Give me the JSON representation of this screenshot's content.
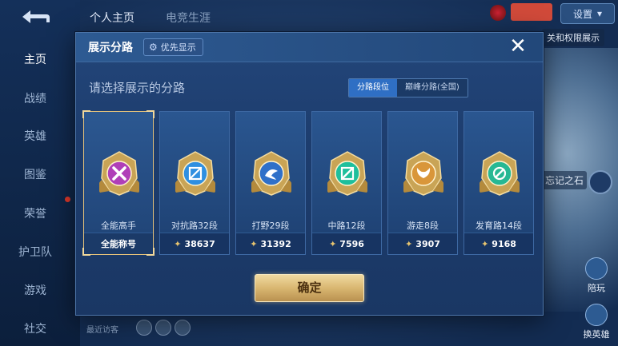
{
  "background": {
    "top_tabs": [
      "个人主页",
      "电竞生涯"
    ],
    "sidebar": [
      {
        "label": "主页",
        "active": true
      },
      {
        "label": "战绩"
      },
      {
        "label": "英雄"
      },
      {
        "label": "图鉴"
      },
      {
        "label": "荣誉"
      },
      {
        "label": "护卫队"
      },
      {
        "label": "游戏"
      },
      {
        "label": "社交"
      }
    ],
    "top_right_button": "设置",
    "peek_right_1": "关和权限展示",
    "peek_right_2": "忘记之石",
    "right_btn_1": "陪玩",
    "right_btn_2": "换英雄",
    "bottom_left_text": "最近访客"
  },
  "modal": {
    "title": "展示分路",
    "priority_label": "优先显示",
    "prompt": "请选择展示的分路",
    "tabs": [
      {
        "label": "分路段位",
        "active": true
      },
      {
        "label": "巅峰分路(全国)",
        "active": false
      }
    ],
    "cards": [
      {
        "name": "全能高手",
        "footer": "全能称号",
        "selected": true,
        "badge_color": "#b03fb8",
        "icon": "x-emblem-icon"
      },
      {
        "name": "对抗路32段",
        "footer": "38637",
        "badge_color": "#2f8fe0",
        "icon": "shield-sword-icon"
      },
      {
        "name": "打野29段",
        "footer": "31392",
        "badge_color": "#2f70c9",
        "icon": "dragon-icon"
      },
      {
        "name": "中路12段",
        "footer": "7596",
        "badge_color": "#1ebf9c",
        "icon": "slash-icon"
      },
      {
        "name": "游走8段",
        "footer": "3907",
        "badge_color": "#d9963a",
        "icon": "wings-icon"
      },
      {
        "name": "发育路14段",
        "footer": "9168",
        "badge_color": "#27b894",
        "icon": "bow-icon"
      }
    ],
    "confirm_label": "确定"
  },
  "colors": {
    "accent_gold": "#e5c27a",
    "tab_active": "#2f6fc4"
  }
}
